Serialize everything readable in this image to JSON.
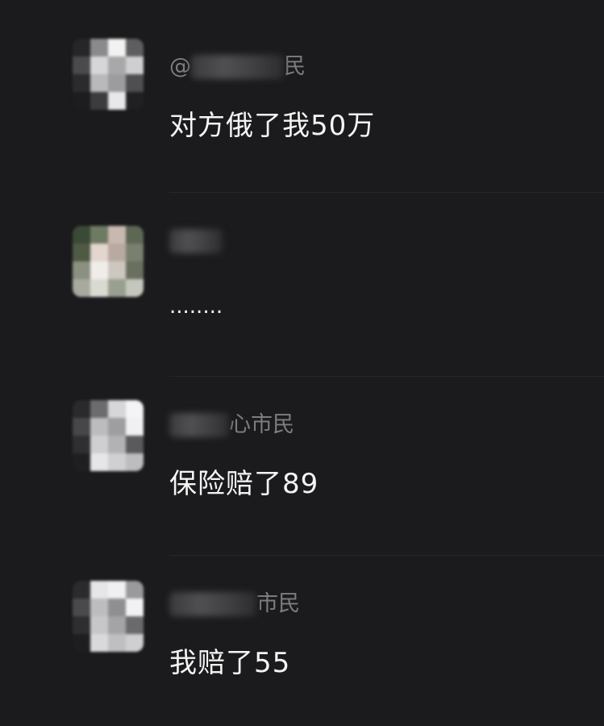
{
  "comments": [
    {
      "username_prefix": "@",
      "username_suffix": "民",
      "text": "对方俄了我50万"
    },
    {
      "username_prefix": "",
      "username_suffix": "",
      "text": "........"
    },
    {
      "username_prefix": "",
      "username_suffix": "心市民",
      "text": "保险赔了89"
    },
    {
      "username_prefix": "",
      "username_suffix": "市民",
      "text": "我赔了55"
    }
  ]
}
